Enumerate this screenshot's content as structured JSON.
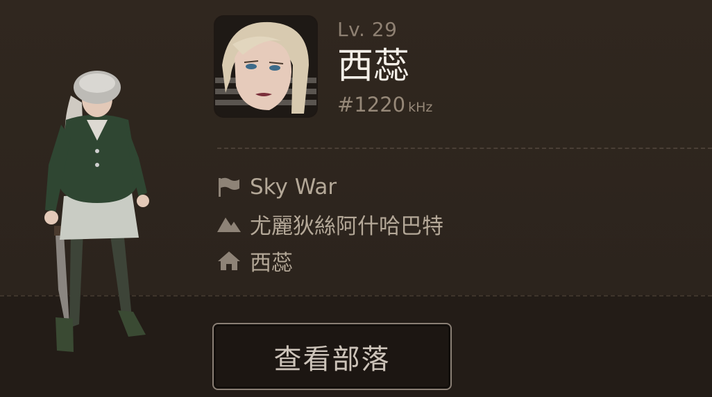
{
  "profile": {
    "level": "Lv. 29",
    "name": "西蕊",
    "frequency": "#1220",
    "frequency_unit": "kHz"
  },
  "info": {
    "tribe": {
      "icon": "flag-icon",
      "text": "Sky War"
    },
    "region": {
      "icon": "mountain-icon",
      "text": "尤麗狄絲阿什哈巴特"
    },
    "home": {
      "icon": "home-icon",
      "text": "西蕊"
    }
  },
  "actions": {
    "view_tribe_label": "查看部落"
  }
}
